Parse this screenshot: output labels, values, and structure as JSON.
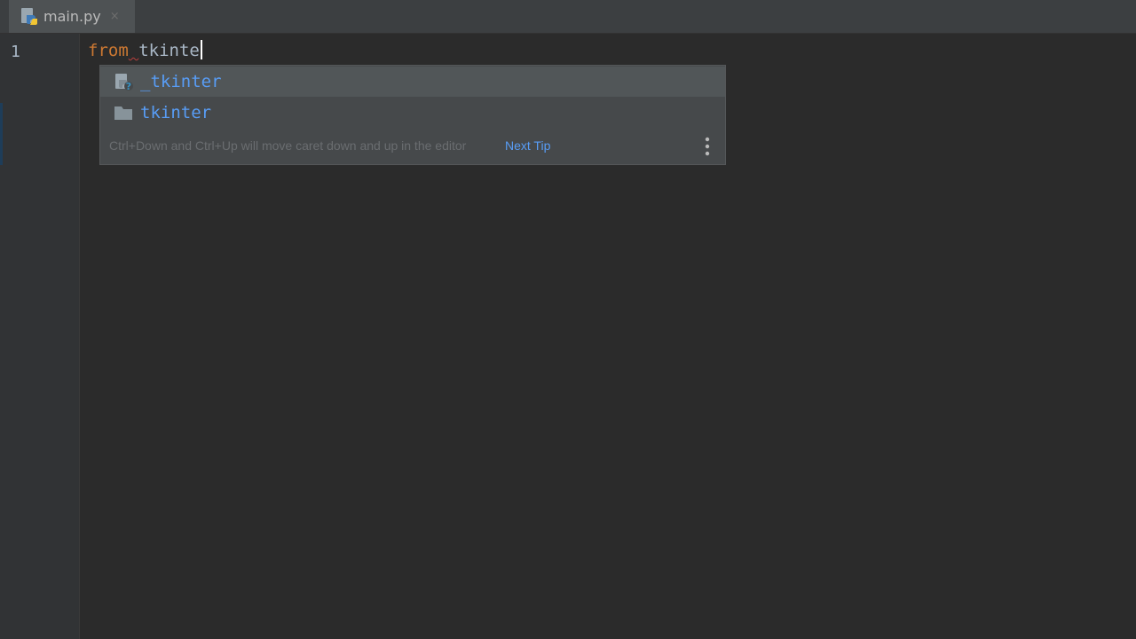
{
  "tabs": [
    {
      "label": "main.py",
      "icon": "python-file-icon",
      "close": "×"
    }
  ],
  "gutter": {
    "line_numbers": [
      "1"
    ]
  },
  "editor": {
    "keyword": "from",
    "space": " ",
    "typed": "tkinte"
  },
  "completion": {
    "items": [
      {
        "label": "_tkinter",
        "icon": "unknown-module-icon"
      },
      {
        "label": "tkinter",
        "icon": "folder-icon"
      }
    ],
    "hint": "Ctrl+Down and Ctrl+Up will move caret down and up in the editor",
    "next_tip": "Next Tip"
  },
  "colors": {
    "background": "#2b2b2b",
    "keyword": "#cc7832",
    "identifier": "#a9b7c6",
    "completion_text": "#589df6",
    "popup_bg": "#46494b",
    "selected_bg": "#515658"
  }
}
